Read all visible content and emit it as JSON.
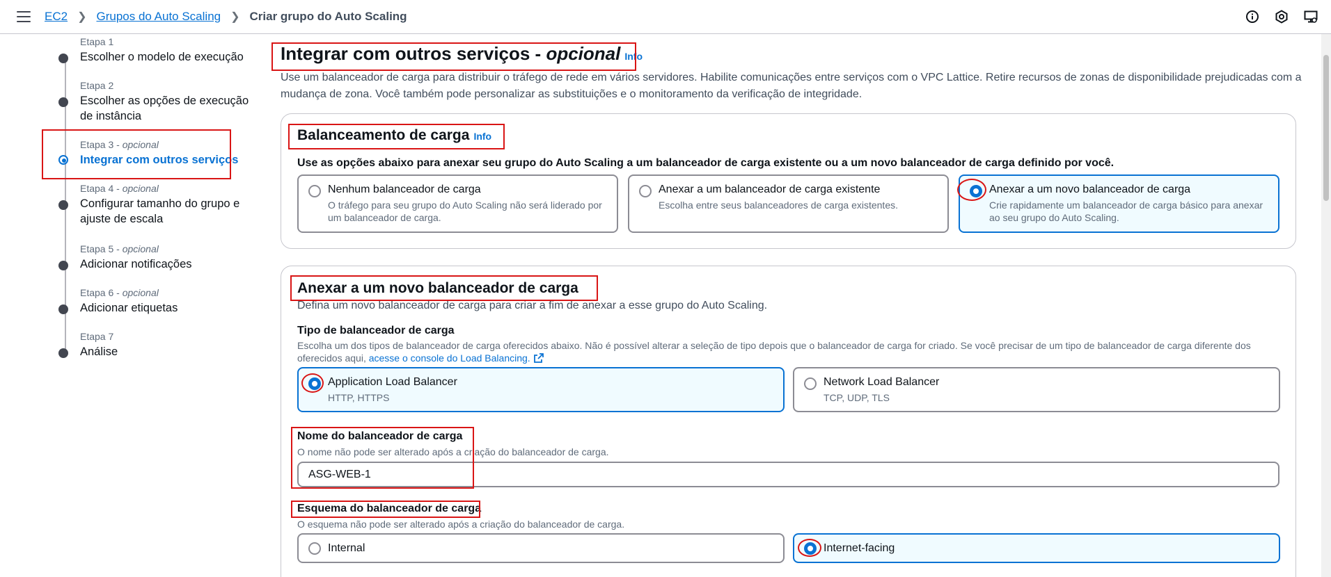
{
  "header": {
    "menu_icon": "hamburger-menu-icon",
    "breadcrumbs": [
      "EC2",
      "Grupos do Auto Scaling",
      "Criar grupo do Auto Scaling"
    ],
    "icons": [
      "info-circle-icon",
      "notifications-icon",
      "display-settings-icon"
    ]
  },
  "steps": [
    {
      "stage": "Etapa 1",
      "optional": "",
      "title": "Escolher o modelo de execução"
    },
    {
      "stage": "Etapa 2",
      "optional": "",
      "title": "Escolher as opções de execução de instância"
    },
    {
      "stage": "Etapa 3 - ",
      "optional": "opcional",
      "title": "Integrar com outros serviços"
    },
    {
      "stage": "Etapa 4 - ",
      "optional": "opcional",
      "title": "Configurar tamanho do grupo e ajuste de escala"
    },
    {
      "stage": "Etapa 5 - ",
      "optional": "opcional",
      "title": "Adicionar notificações"
    },
    {
      "stage": "Etapa 6 - ",
      "optional": "opcional",
      "title": "Adicionar etiquetas"
    },
    {
      "stage": "Etapa 7",
      "optional": "",
      "title": "Análise"
    }
  ],
  "main": {
    "title": "Integrar com outros serviços - ",
    "title_optional": "opcional",
    "info": "Info",
    "description": "Use um balanceador de carga para distribuir o tráfego de rede em vários servidores. Habilite comunicações entre serviços com o VPC Lattice. Retire recursos de zonas de disponibilidade prejudicadas com a mudança de zona. Você também pode personalizar as substituições e o monitoramento da verificação de integridade."
  },
  "load_balancing": {
    "title": "Balanceamento de carga",
    "info": "Info",
    "instruction": "Use as opções abaixo para anexar seu grupo do Auto Scaling a um balanceador de carga existente ou a um novo balanceador de carga definido por você.",
    "options": [
      {
        "label": "Nenhum balanceador de carga",
        "desc": "O tráfego para seu grupo do Auto Scaling não será liderado por um balanceador de carga.",
        "selected": false
      },
      {
        "label": "Anexar a um balanceador de carga existente",
        "desc": "Escolha entre seus balanceadores de carga existentes.",
        "selected": false
      },
      {
        "label": "Anexar a um novo balanceador de carga",
        "desc": "Crie rapidamente um balanceador de carga básico para anexar ao seu grupo do Auto Scaling.",
        "selected": true
      }
    ]
  },
  "new_lb": {
    "title": "Anexar a um novo balanceador de carga",
    "description": "Defina um novo balanceador de carga para criar a fim de anexar a esse grupo do Auto Scaling.",
    "type_label": "Tipo de balanceador de carga",
    "type_desc": "Escolha um dos tipos de balanceador de carga oferecidos abaixo. Não é possível alterar a seleção de tipo depois que o balanceador de carga for criado. Se você precisar de um tipo de balanceador de carga diferente dos oferecidos aqui, ",
    "type_link": "acesse o console do Load Balancing.",
    "types": [
      {
        "label": "Application Load Balancer",
        "desc": "HTTP, HTTPS",
        "selected": true
      },
      {
        "label": "Network Load Balancer",
        "desc": "TCP, UDP, TLS",
        "selected": false
      }
    ],
    "name_label": "Nome do balanceador de carga",
    "name_desc": "O nome não pode ser alterado após a criação do balanceador de carga.",
    "name_value": "ASG-WEB-1",
    "scheme_label": "Esquema do balanceador de carga",
    "scheme_desc": "O esquema não pode ser alterado após a criação do balanceador de carga.",
    "schemes": [
      {
        "label": "Internal",
        "selected": false
      },
      {
        "label": "Internet-facing",
        "selected": true
      }
    ]
  },
  "colors": {
    "accent": "#0972d3",
    "annotation": "#d91515",
    "selected_bg": "#f0fbff"
  }
}
